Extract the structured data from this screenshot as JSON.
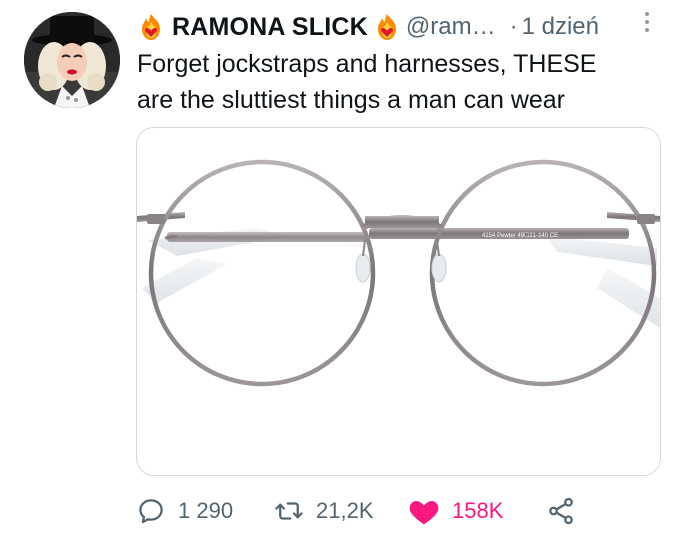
{
  "tweet": {
    "author": {
      "display_name": "RAMONA SLICK",
      "handle": "@ram…",
      "badge_icon": "flame-heart-emoji"
    },
    "time_separator": "·",
    "timestamp": "1 dzień",
    "text_lines": [
      "Forget jockstraps and harnesses, THESE",
      "are the sluttiest things a man can wear"
    ],
    "media": {
      "subject": "eyeglasses",
      "arm_imprint": "4154 Pewter 49☐21-140 CE"
    },
    "actions": {
      "reply_count": "1 290",
      "retweet_count": "21,2K",
      "like_count": "158K",
      "like_active": true
    }
  },
  "colors": {
    "text": "#0f1419",
    "secondary": "#536471",
    "like": "#f91880",
    "border": "#cfd9de"
  }
}
